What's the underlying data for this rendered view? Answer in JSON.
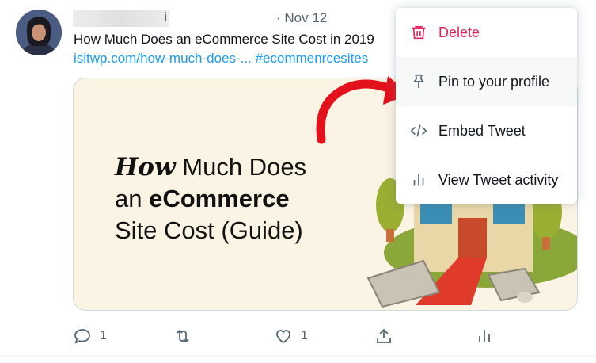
{
  "tweet": {
    "name_suffix": "i",
    "date": "· Nov 12",
    "text": "How Much Does an eCommerce Site Cost in 2019",
    "link": "isitwp.com/how-much-does-...",
    "hashtag": "#ecommenrcesites"
  },
  "card": {
    "title_how": "How",
    "title_line1_rest": " Much Does",
    "title_line2_an": "an ",
    "title_line2_bold": "eCommerce",
    "title_line3": "Site Cost (Guide)"
  },
  "actions": {
    "reply_count": "1",
    "like_count": "1"
  },
  "menu": {
    "items": [
      {
        "label": "Delete",
        "icon": "trash-icon",
        "color": "#e0245e"
      },
      {
        "label": "Pin to your profile",
        "icon": "pin-icon"
      },
      {
        "label": "Embed Tweet",
        "icon": "code-icon"
      },
      {
        "label": "View Tweet activity",
        "icon": "bar-chart-icon"
      }
    ]
  },
  "colors": {
    "accent": "#1d9bf0",
    "danger": "#e0245e",
    "arrow": "#e3111b",
    "card_bg": "#fbf3e4"
  }
}
